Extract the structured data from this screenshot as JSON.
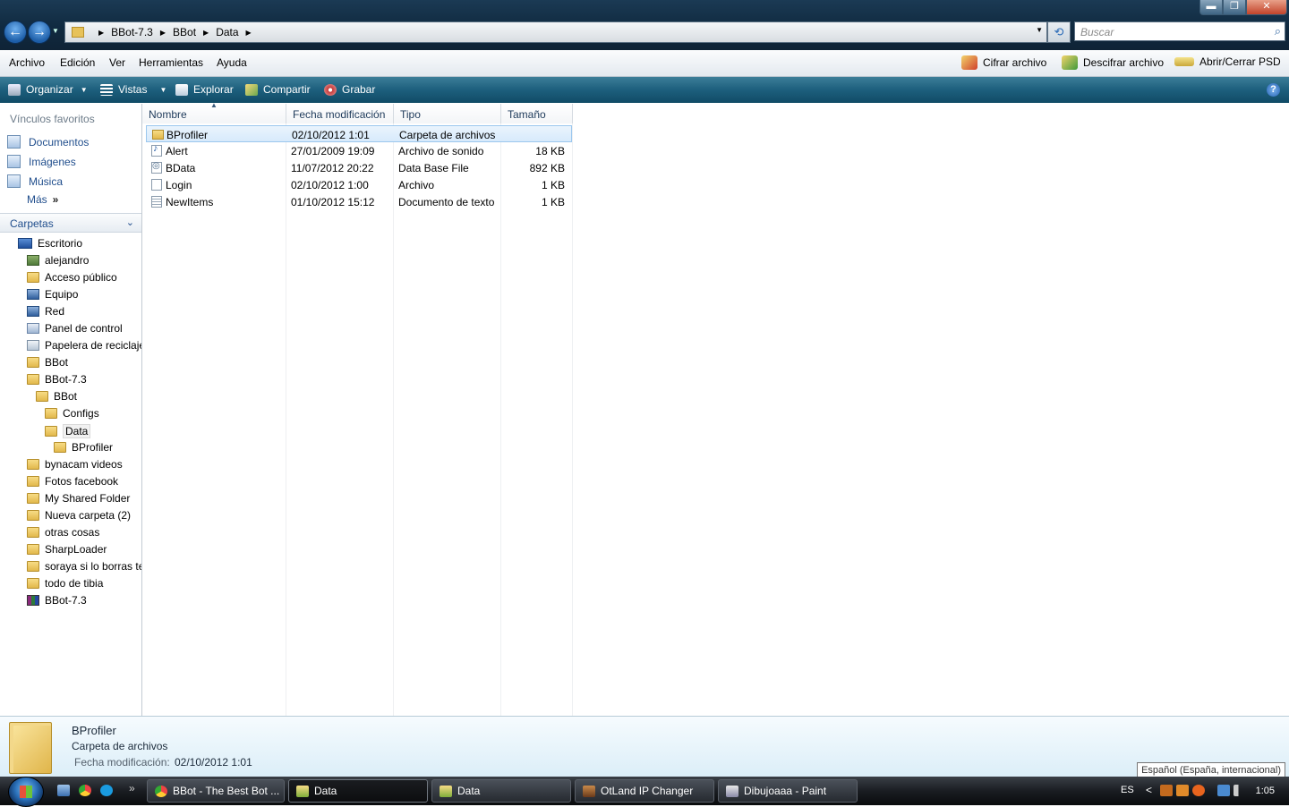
{
  "window": {
    "controls": {
      "minimize": "▬",
      "maximize": "❐",
      "close": "✕"
    }
  },
  "address": {
    "crumbs": [
      "BBot-7.3",
      "BBot",
      "Data"
    ],
    "search_placeholder": "Buscar"
  },
  "menu": {
    "items": [
      "Archivo",
      "Edición",
      "Ver",
      "Herramientas",
      "Ayuda"
    ],
    "tools": [
      "Cifrar archivo",
      "Descifrar archivo",
      "Abrir/Cerrar PSD"
    ]
  },
  "commands": {
    "organize": "Organizar",
    "views": "Vistas",
    "explore": "Explorar",
    "share": "Compartir",
    "burn": "Grabar",
    "help": "?"
  },
  "nav": {
    "favorites_title": "Vínculos favoritos",
    "favorites": [
      "Documentos",
      "Imágenes",
      "Música"
    ],
    "more": "Más",
    "folders_title": "Carpetas",
    "tree": [
      {
        "label": "Escritorio",
        "depth": 0,
        "icon": "desktop-icon"
      },
      {
        "label": "alejandro",
        "depth": 1,
        "icon": "user-icon"
      },
      {
        "label": "Acceso público",
        "depth": 1,
        "icon": "folder-icon"
      },
      {
        "label": "Equipo",
        "depth": 1,
        "icon": "computer-icon"
      },
      {
        "label": "Red",
        "depth": 1,
        "icon": "network-icon"
      },
      {
        "label": "Panel de control",
        "depth": 1,
        "icon": "control-panel-icon"
      },
      {
        "label": "Papelera de reciclaje",
        "depth": 1,
        "icon": "recycle-bin-icon"
      },
      {
        "label": "BBot",
        "depth": 1,
        "icon": "folder-icon"
      },
      {
        "label": "BBot-7.3",
        "depth": 1,
        "icon": "folder-icon"
      },
      {
        "label": "BBot",
        "depth": 2,
        "icon": "folder-icon"
      },
      {
        "label": "Configs",
        "depth": 3,
        "icon": "folder-icon"
      },
      {
        "label": "Data",
        "depth": 3,
        "icon": "folder-icon",
        "selected": true
      },
      {
        "label": "BProfiler",
        "depth": 4,
        "icon": "folder-icon"
      },
      {
        "label": "bynacam videos",
        "depth": 1,
        "icon": "folder-icon"
      },
      {
        "label": "Fotos facebook",
        "depth": 1,
        "icon": "folder-icon"
      },
      {
        "label": "My Shared Folder",
        "depth": 1,
        "icon": "folder-icon"
      },
      {
        "label": "Nueva carpeta (2)",
        "depth": 1,
        "icon": "folder-icon"
      },
      {
        "label": "otras cosas",
        "depth": 1,
        "icon": "folder-icon"
      },
      {
        "label": "SharpLoader",
        "depth": 1,
        "icon": "folder-icon"
      },
      {
        "label": "soraya  si lo borras te mato",
        "depth": 1,
        "icon": "folder-icon"
      },
      {
        "label": "todo de tibia",
        "depth": 1,
        "icon": "folder-icon"
      },
      {
        "label": "BBot-7.3",
        "depth": 1,
        "icon": "archive-icon"
      }
    ]
  },
  "files": {
    "columns": [
      "Nombre",
      "Fecha modificación",
      "Tipo",
      "Tamaño"
    ],
    "rows": [
      {
        "name": "BProfiler",
        "date": "02/10/2012 1:01",
        "type": "Carpeta de archivos",
        "size": "",
        "icon": "folder-icon",
        "selected": true
      },
      {
        "name": "Alert",
        "date": "27/01/2009 19:09",
        "type": "Archivo de sonido",
        "size": "18 KB",
        "icon": "sound-file-icon"
      },
      {
        "name": "BData",
        "date": "11/07/2012 20:22",
        "type": "Data Base File",
        "size": "892 KB",
        "icon": "database-file-icon"
      },
      {
        "name": "Login",
        "date": "02/10/2012 1:00",
        "type": "Archivo",
        "size": "1 KB",
        "icon": "file-icon"
      },
      {
        "name": "NewItems",
        "date": "01/10/2012 15:12",
        "type": "Documento de texto",
        "size": "1 KB",
        "icon": "text-file-icon"
      }
    ]
  },
  "details": {
    "name": "BProfiler",
    "type": "Carpeta de archivos",
    "modified_label": "Fecha modificación:",
    "modified_value": "02/10/2012 1:01"
  },
  "tooltip": "Español (España, internacional)",
  "taskbar": {
    "more": "»",
    "tasks": [
      "BBot - The Best Bot ...",
      "Data",
      "Data",
      "OtLand IP Changer",
      "Dibujoaaa - Paint"
    ],
    "lang": "ES",
    "tray_arrow": "<",
    "clock": "1:05"
  }
}
